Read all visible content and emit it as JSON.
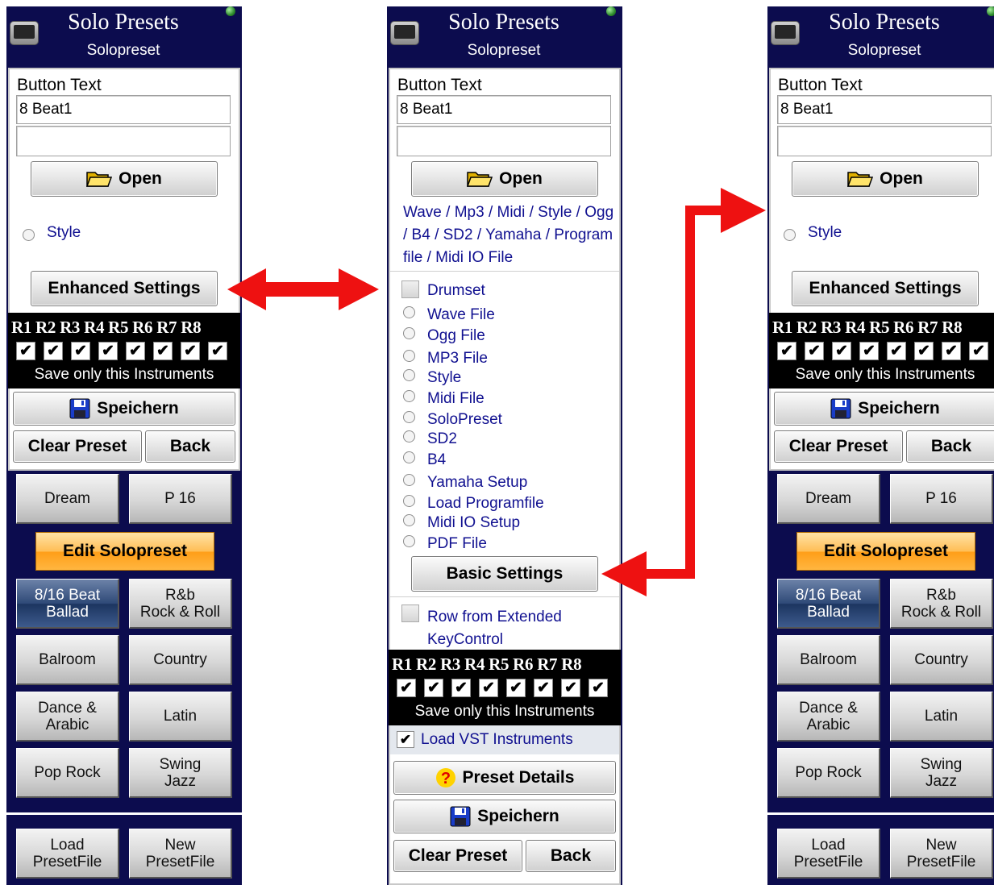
{
  "header": {
    "title": "Solo Presets",
    "subtitle": "Solopreset"
  },
  "editor": {
    "button_text_label": "Button Text",
    "button_text_value": "8 Beat1",
    "button_text_line2": "",
    "open_label": "Open",
    "style_radio_label": "Style",
    "enhanced_settings_label": "Enhanced Settings",
    "basic_settings_label": "Basic Settings",
    "file_types_text": "Wave / Mp3 / Midi / Style / Ogg / B4 / SD2 / Yamaha / Program file / Midi IO File",
    "drumset_label": "Drumset",
    "file_options": [
      "Wave File",
      "Ogg File",
      "MP3 File",
      "Style",
      "Midi File",
      "SoloPreset",
      "SD2",
      "B4",
      "Yamaha Setup",
      "Load Programfile",
      "Midi IO Setup",
      "PDF File"
    ],
    "row_from_extended_label": "Row  from Extended KeyControl",
    "load_vst_label": "Load VST Instruments",
    "load_vst_checked": true,
    "preset_details_label": "Preset Details",
    "save_label": "Speichern",
    "clear_preset_label": "Clear Preset",
    "back_label": "Back"
  },
  "instruments": {
    "rows": [
      "R1",
      "R2",
      "R3",
      "R4",
      "R5",
      "R6",
      "R7",
      "R8"
    ],
    "checked": [
      true,
      true,
      true,
      true,
      true,
      true,
      true,
      true
    ],
    "footer": "Save only this Instruments"
  },
  "presets": {
    "dream": "Dream",
    "p16": "P 16",
    "edit_solopreset": "Edit Solopreset",
    "beat_l1": "8/16 Beat",
    "beat_l2": "Ballad",
    "rb_l1": "R&b",
    "rb_l2": "Rock & Roll",
    "balroom": "Balroom",
    "country": "Country",
    "dance_l1": "Dance &",
    "dance_l2": "Arabic",
    "latin": "Latin",
    "pop_rock": "Pop Rock",
    "swing_l1": "Swing",
    "swing_l2": "Jazz",
    "load_l1": "Load",
    "load_l2": "PresetFile",
    "new_l1": "New",
    "new_l2": "PresetFile"
  },
  "colors": {
    "panel_bg": "#0c0c4e",
    "arrow": "#ee1111",
    "accent_orange": "#ffb640",
    "link_blue": "#101090"
  },
  "icons": [
    "monitor-icon",
    "status-led-icon",
    "folder-open-icon",
    "floppy-disk-icon",
    "question-icon",
    "arrow-icon"
  ]
}
